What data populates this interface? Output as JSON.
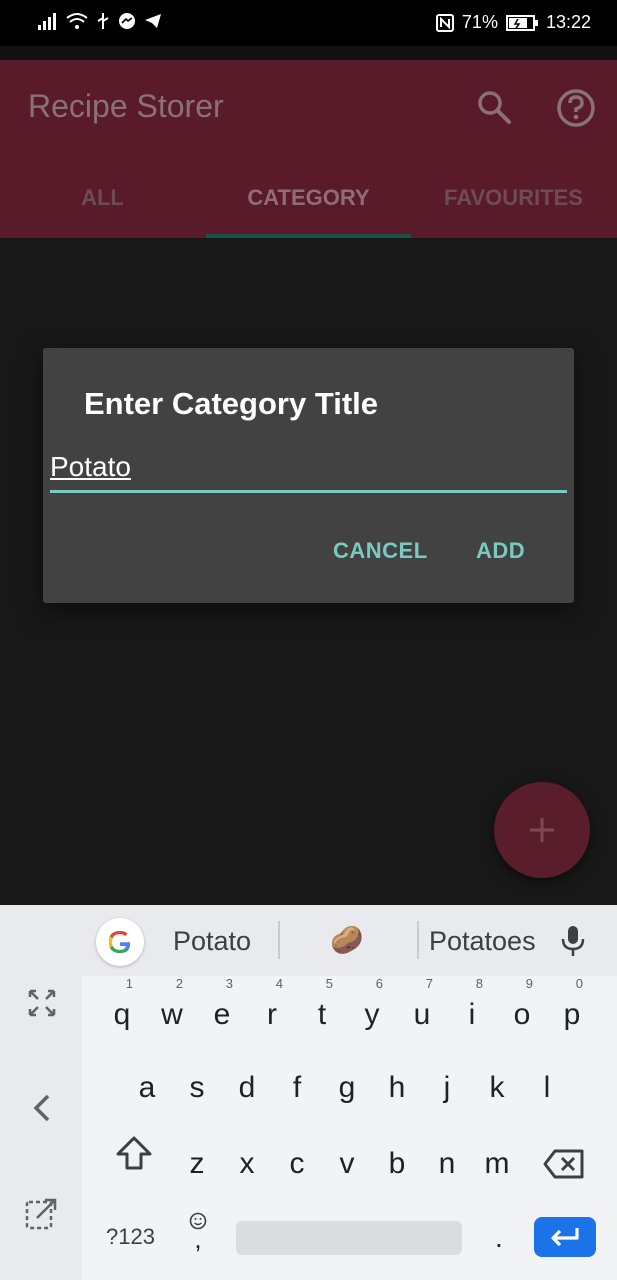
{
  "status_bar": {
    "battery": "71%",
    "time": "13:22"
  },
  "app": {
    "title": "Recipe Storer"
  },
  "tabs": [
    {
      "label": "ALL"
    },
    {
      "label": "CATEGORY"
    },
    {
      "label": "FAVOURITES"
    }
  ],
  "dialog": {
    "title": "Enter Category Title",
    "input_value": "Potato",
    "cancel_label": "CANCEL",
    "add_label": "ADD"
  },
  "fab": {
    "icon": "plus-icon"
  },
  "keyboard": {
    "suggestions": [
      "Potato",
      "🥔",
      "Potatoes"
    ],
    "row1": [
      "q",
      "w",
      "e",
      "r",
      "t",
      "y",
      "u",
      "i",
      "o",
      "p"
    ],
    "row1_hints": [
      "1",
      "2",
      "3",
      "4",
      "5",
      "6",
      "7",
      "8",
      "9",
      "0"
    ],
    "row2": [
      "a",
      "s",
      "d",
      "f",
      "g",
      "h",
      "j",
      "k",
      "l"
    ],
    "row3": [
      "z",
      "x",
      "c",
      "v",
      "b",
      "n",
      "m"
    ],
    "symbols_label": "?123",
    "comma": ",",
    "period": "."
  },
  "colors": {
    "app_bar": "#591b2a",
    "accent": "#79cac0",
    "dialog_bg": "#424242",
    "enter_key": "#1a73e8"
  }
}
